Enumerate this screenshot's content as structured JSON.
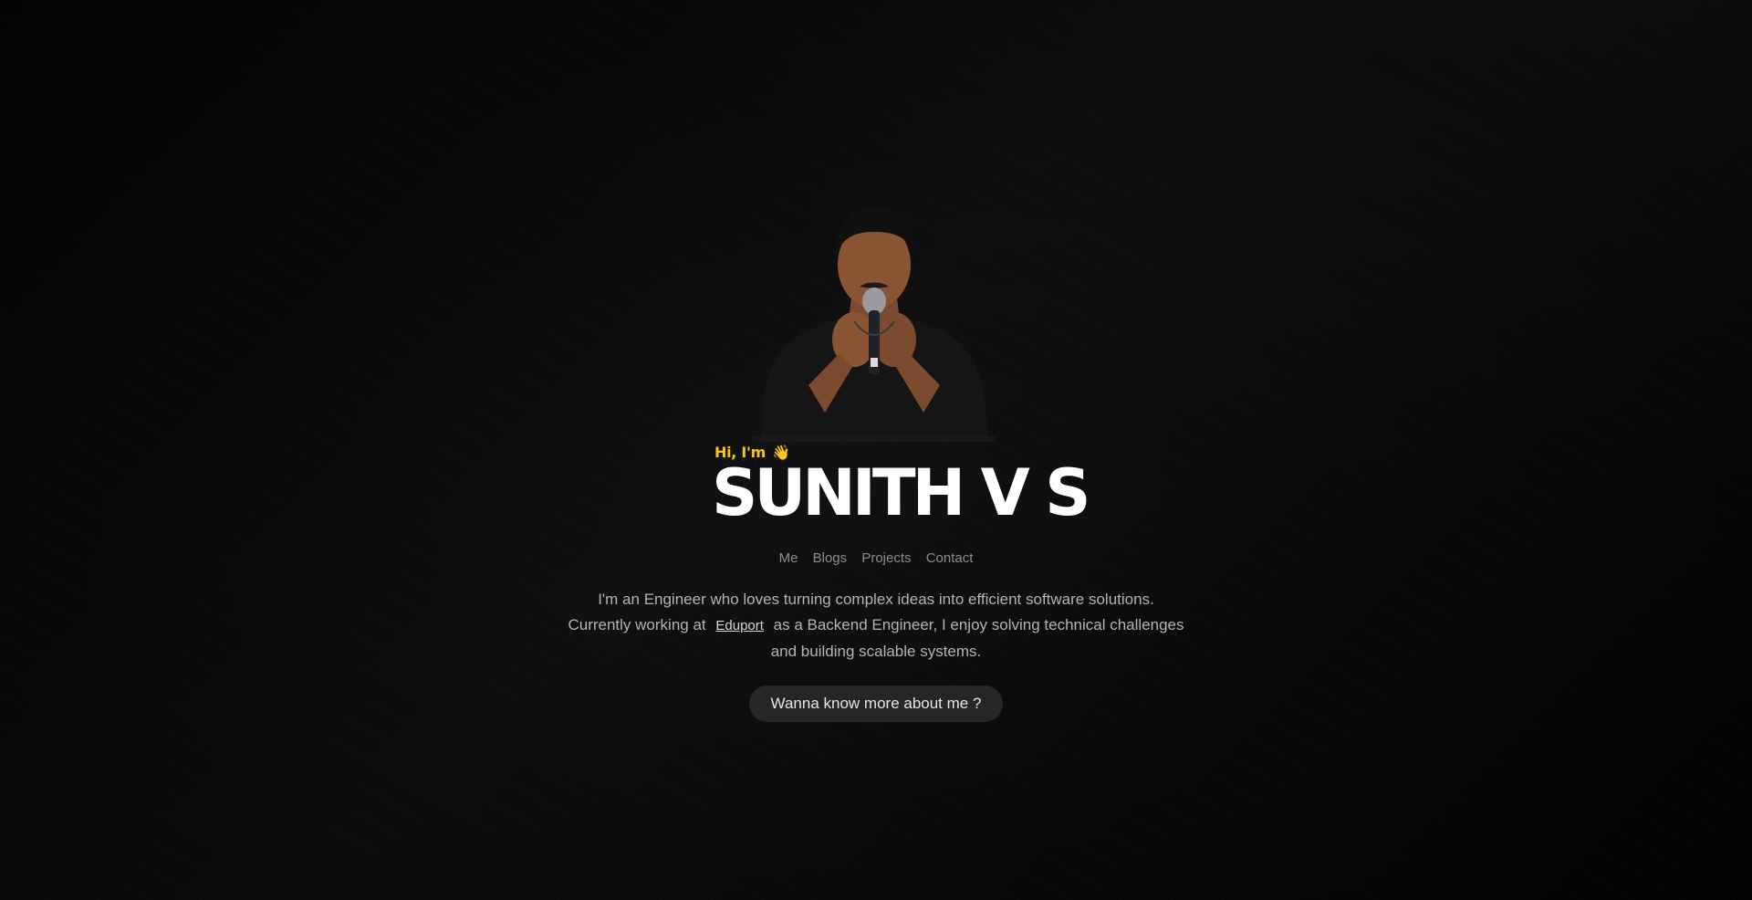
{
  "hero": {
    "greeting": "Hi, I'm",
    "greeting_emoji": "👋",
    "name": "SUNITH V S",
    "accent_color": "#f5c518",
    "portrait_alt": "Portrait of Sunith V S holding a microphone"
  },
  "nav": {
    "items": [
      {
        "label": "Me"
      },
      {
        "label": "Blogs"
      },
      {
        "label": "Projects"
      },
      {
        "label": "Contact"
      }
    ]
  },
  "bio": {
    "line1": "I'm an Engineer who loves turning complex ideas into efficient software solutions.",
    "line2_prefix": "Currently working at",
    "company_link": "Eduport",
    "line2_suffix": "as a Backend Engineer, I enjoy solving technical challenges and building scalable systems."
  },
  "cta": {
    "label": "Wanna know more about me ?"
  }
}
